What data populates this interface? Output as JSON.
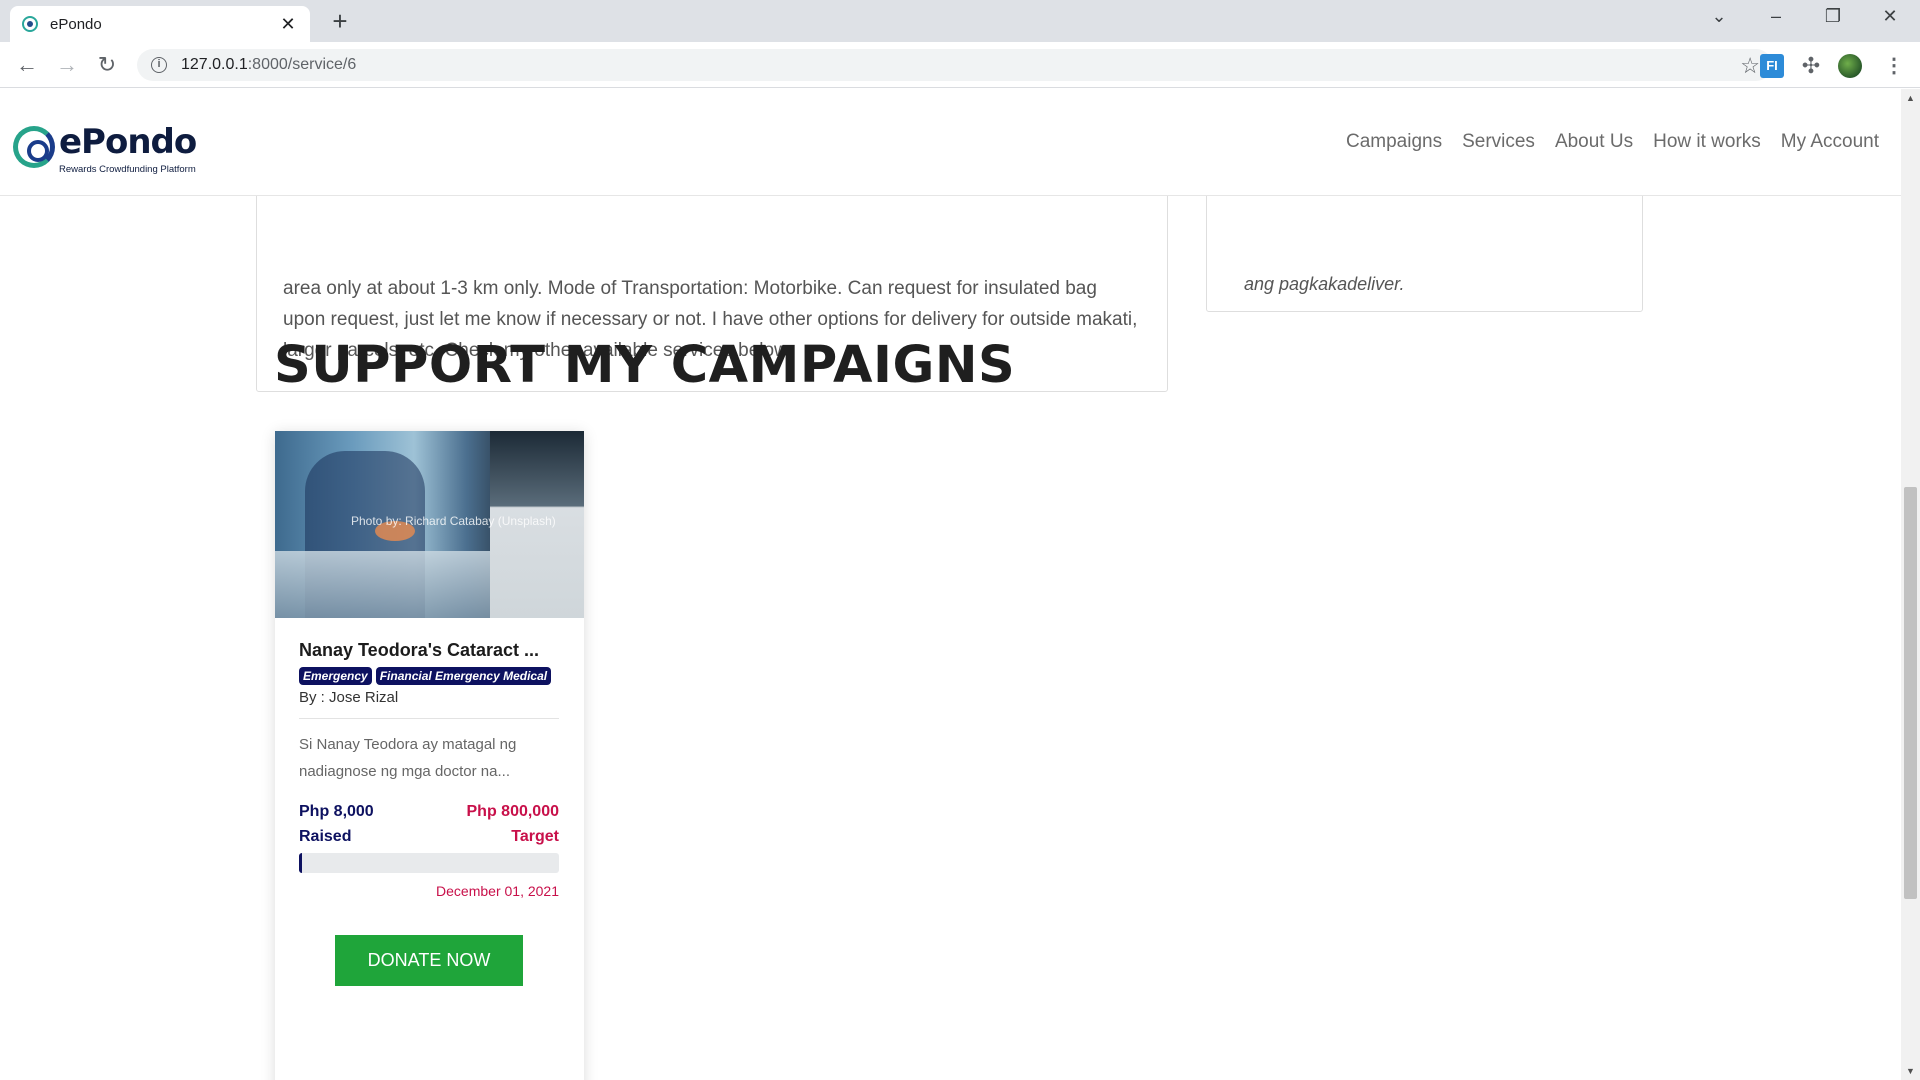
{
  "browser": {
    "tab_title": "ePondo",
    "url_host": "127.0.0.1",
    "url_path": ":8000/service/6",
    "ext_label": "FI"
  },
  "site": {
    "logo_text": "ePondo",
    "logo_tagline": "Rewards Crowdfunding Platform",
    "nav": [
      "Campaigns",
      "Services",
      "About Us",
      "How it works",
      "My Account"
    ]
  },
  "service": {
    "description_tail": "area only at about 1-3 km only. Mode of Transportation: Motorbike. Can request for insulated bag upon request, just let me know if necessary or not. I have other options for delivery for outside makati, larger parcels, etc. Check my other available services below.",
    "side_text": "ang pagkakadeliver."
  },
  "section_title": "SUPPORT MY CAMPAIGNS",
  "campaign": {
    "photo_credit": "Photo by: Richard Catabay (Unsplash)",
    "title": "Nanay Teodora's Cataract ...",
    "tags": [
      "Emergency",
      "Financial Emergency Medical"
    ],
    "author": "By : Jose Rizal",
    "description": "Si Nanay Teodora ay matagal ng nadiagnose ng mga doctor na...",
    "raised_amount": "Php 8,000",
    "raised_label": "Raised",
    "target_amount": "Php 800,000",
    "target_label": "Target",
    "progress_fraction": 0.01,
    "date": "December 01, 2021",
    "donate_label": "DONATE NOW"
  },
  "colors": {
    "brand_navy": "#0d1160",
    "target_red": "#c8104a",
    "donate_green": "#1fa53a"
  }
}
